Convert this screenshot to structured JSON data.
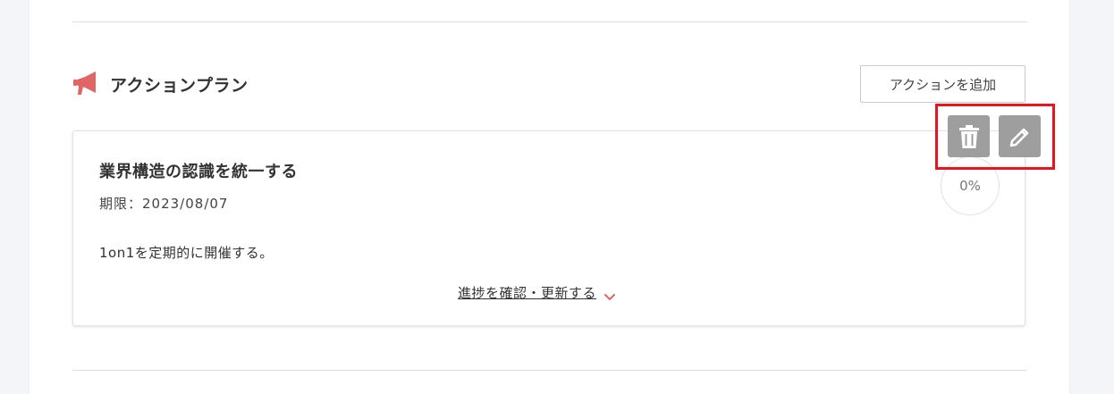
{
  "section": {
    "title": "アクションプラン",
    "icon": "megaphone-icon",
    "add_button_label": "アクションを追加"
  },
  "action_plan": {
    "title": "業界構造の認識を統一する",
    "deadline": "期限：2023/08/07",
    "description": "1on1を定期的に開催する。",
    "progress": "0%",
    "progress_link_label": "進捗を確認・更新する"
  },
  "actions": {
    "delete_icon": "trash-icon",
    "edit_icon": "pencil-icon"
  },
  "colors": {
    "accent": "#e06666",
    "highlight_border": "#e8141e",
    "icon_button_bg": "#9e9e9e",
    "page_background": "#f4f5f9"
  }
}
